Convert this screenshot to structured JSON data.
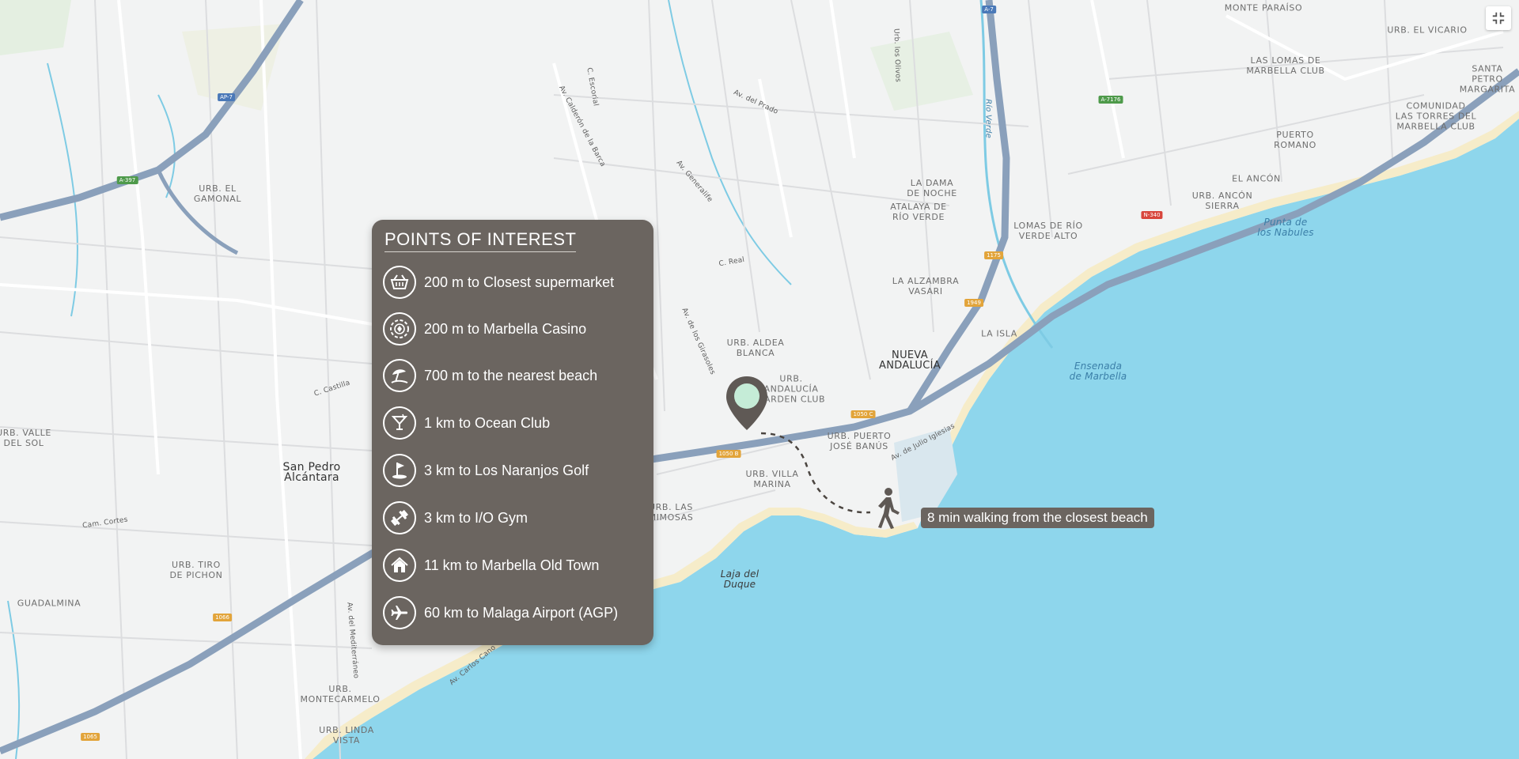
{
  "poi_panel": {
    "title": "POINTS OF INTEREST",
    "items": [
      {
        "icon": "basket-icon",
        "label": "200 m to Closest supermarket"
      },
      {
        "icon": "casino-chip-icon",
        "label": "200 m to Marbella Casino"
      },
      {
        "icon": "beach-umbrella-icon",
        "label": "700 m to the nearest beach"
      },
      {
        "icon": "cocktail-icon",
        "label": "1 km to Ocean Club"
      },
      {
        "icon": "golf-flag-icon",
        "label": "3 km to Los Naranjos Golf"
      },
      {
        "icon": "dumbbell-icon",
        "label": "3 km to I/O Gym"
      },
      {
        "icon": "home-icon",
        "label": "11 km to Marbella Old Town"
      },
      {
        "icon": "airplane-icon",
        "label": "60 km to Malaga Airport (AGP)"
      }
    ]
  },
  "walking_label": "8 min walking from the closest beach",
  "colors": {
    "panel": "#6b6560",
    "sea": "#8ed6ec",
    "land": "#f2f3f3",
    "beach": "#f6ecc9",
    "highway": "#8aa0bb",
    "pin_fill": "#5f5955",
    "pin_dot": "#c5ecd7"
  },
  "map": {
    "places": [
      {
        "text": "MONTE PARAÍSO"
      },
      {
        "text": "URB. EL VICARIO"
      },
      {
        "text": "LAS LOMAS DE\nMARBELLA CLUB"
      },
      {
        "text": "SANTA\nPETRO\nMARGARITA"
      },
      {
        "text": "COMUNIDAD\nLAS TORRES DEL\nMARBELLA CLUB"
      },
      {
        "text": "PUERTO\nROMANO"
      },
      {
        "text": "EL ANCÓN"
      },
      {
        "text": "URB. ANCÓN\nSIERRA"
      },
      {
        "text": "LA DAMA\nDE NOCHE"
      },
      {
        "text": "ATALAYA DE\nRÍO VERDE"
      },
      {
        "text": "LOMAS DE RÍO\nVERDE ALTO"
      },
      {
        "text": "LA ALZAMBRA\nVASARI"
      },
      {
        "text": "LA ISLA"
      },
      {
        "text": "NUEVA\nANDALUCÍA"
      },
      {
        "text": "URB. ALDEA\nBLANCA"
      },
      {
        "text": "URB.\nANDALUCÍA\nGARDEN CLUB"
      },
      {
        "text": "URB. PUERTO\nJOSÉ BANÚS"
      },
      {
        "text": "URB. VILLA\nMARINA"
      },
      {
        "text": "URB. LAS\nMIMOSAS"
      },
      {
        "text": "URB. EL\nGAMONAL"
      },
      {
        "text": "URB. VALLE\nDEL SOL"
      },
      {
        "text": "URB. TIRO\nDE PICHON"
      },
      {
        "text": "GUADALMINA"
      },
      {
        "text": "URB.\nMONTECARMELO"
      },
      {
        "text": "URB. LINDA\nVISTA"
      }
    ],
    "towns": [
      {
        "text": "San Pedro\nAlcántara"
      }
    ],
    "water": [
      {
        "text": "Punta de\nlos Nabules"
      },
      {
        "text": "Ensenada\nde Marbella"
      },
      {
        "text": "Laja del\nDuque"
      },
      {
        "text": "Río Verde"
      }
    ],
    "streets": [
      {
        "text": "Av. Calderón de la Barca"
      },
      {
        "text": "Av. de los Girasoles"
      },
      {
        "text": "Av. de Julio Iglesias"
      },
      {
        "text": "C. Castilla"
      },
      {
        "text": "Av. Generalife"
      },
      {
        "text": "Av. del Prado"
      },
      {
        "text": "Av. del Mediterráneo"
      },
      {
        "text": "Av. Carlos Cano"
      },
      {
        "text": "Cam. Cortes"
      },
      {
        "text": "C. Real"
      },
      {
        "text": "Urb. los Olivos"
      },
      {
        "text": "C. Escorial"
      }
    ],
    "shields": [
      {
        "text": "AP-7"
      },
      {
        "text": "A-7"
      },
      {
        "text": "A-397"
      },
      {
        "text": "N-340"
      },
      {
        "text": "A-7176"
      },
      {
        "text": "1050 B"
      },
      {
        "text": "1050 C"
      },
      {
        "text": "1175"
      },
      {
        "text": "1949"
      },
      {
        "text": "1066"
      },
      {
        "text": "1065"
      }
    ]
  }
}
